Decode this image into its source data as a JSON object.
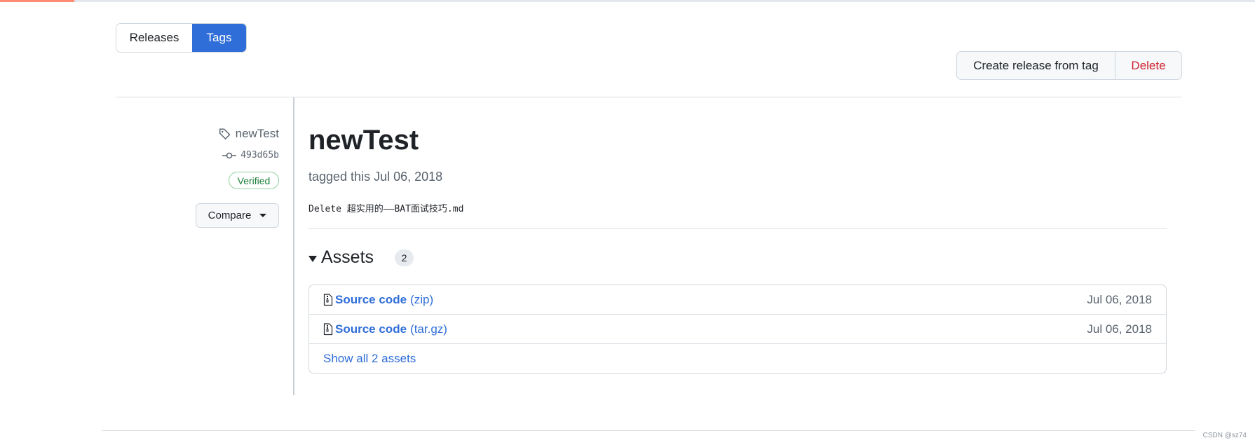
{
  "tabs": {
    "releases": "Releases",
    "tags": "Tags"
  },
  "actions": {
    "create": "Create release from tag",
    "delete": "Delete"
  },
  "tag": {
    "name": "newTest",
    "commit": "493d65b",
    "verified": "Verified",
    "compare": "Compare"
  },
  "release": {
    "title": "newTest",
    "tagged": "tagged this Jul 06, 2018",
    "commit_message": "Delete 超实用的——BAT面试技巧.md"
  },
  "assets": {
    "title": "Assets",
    "count": "2",
    "items": [
      {
        "name": "Source code",
        "ext": "(zip)",
        "date": "Jul 06, 2018"
      },
      {
        "name": "Source code",
        "ext": "(tar.gz)",
        "date": "Jul 06, 2018"
      }
    ],
    "show_all": "Show all 2 assets"
  },
  "watermark": "CSDN @sz74",
  "colors": {
    "accent": "#2f6ed8",
    "danger": "#cf222e",
    "success": "#1a7f37"
  },
  "icons": {
    "tag": "tag-icon",
    "commit": "commit-icon",
    "archive": "file-zip-icon"
  }
}
